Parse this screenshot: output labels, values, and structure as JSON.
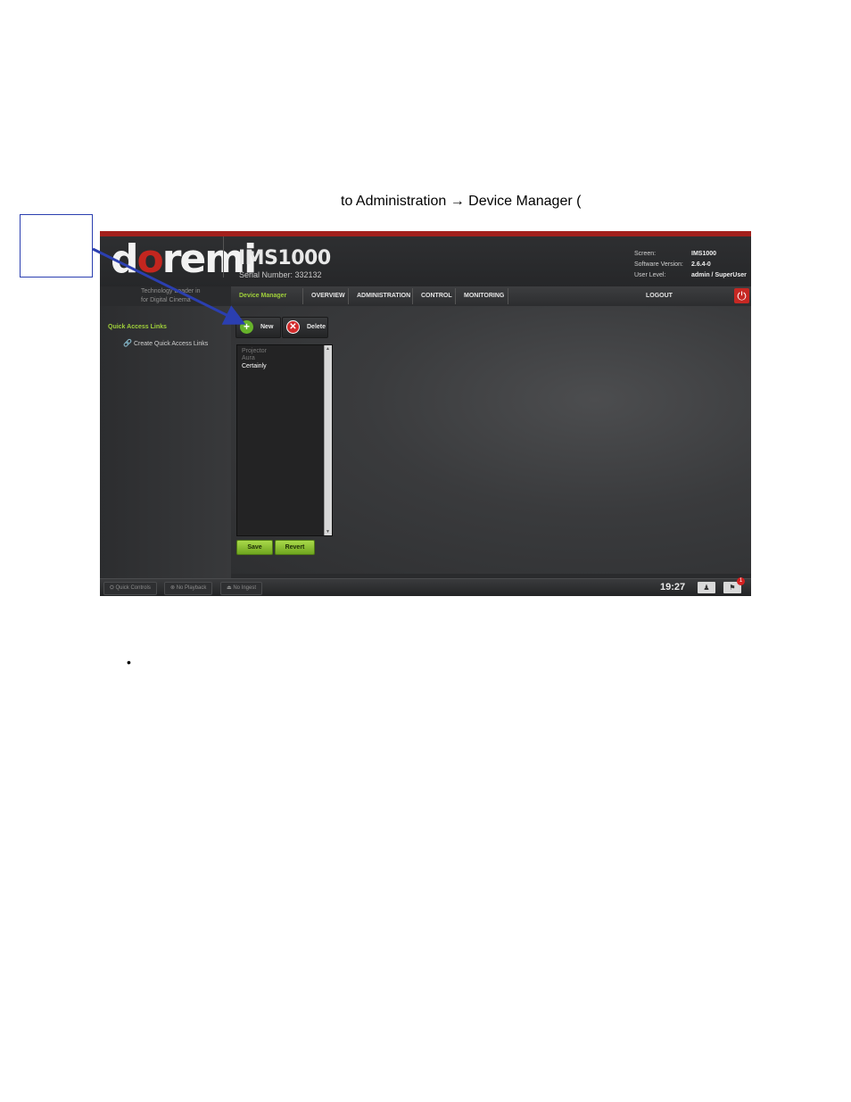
{
  "document": {
    "instruction_text": "to Administration → Device Manager (",
    "bullet": "•"
  },
  "app": {
    "logo": {
      "part1": "d",
      "part2": "o",
      "part3": "remi"
    },
    "tagline_line1": "Technology Leader in",
    "tagline_line2": "for Digital Cinema",
    "product": "IMS1000",
    "serial": "Serial Number: 332132",
    "info": {
      "screen_label": "Screen:",
      "screen_value": "IMS1000",
      "software_label": "Software Version:",
      "software_value": "2.6.4-0",
      "user_label": "User Level:",
      "user_value": "admin / SuperUser"
    }
  },
  "nav": {
    "current": "Device Manager",
    "items": [
      "OVERVIEW",
      "ADMINISTRATION",
      "CONTROL",
      "MONITORING"
    ],
    "logout": "LOGOUT",
    "power_icon": "⏻"
  },
  "sidebar": {
    "title": "Quick Access Links",
    "link": "Create Quick Access Links",
    "link_icon": "🔗"
  },
  "toolbar": {
    "new_label": "New",
    "new_icon": "+",
    "delete_label": "Delete",
    "delete_icon": "✕"
  },
  "device_list": {
    "items": [
      "Projector",
      "Aura",
      "Certainly"
    ]
  },
  "actions": {
    "save": "Save",
    "revert": "Revert"
  },
  "footer": {
    "quick_controls": "Quick Controls",
    "no_playback": "No Playback",
    "no_ingest": "No Ingest",
    "time": "19:27",
    "notifications": "1"
  },
  "colors": {
    "accent_green": "#9fcf3a",
    "brand_red": "#c3261f",
    "annotation_blue": "#2b3fb0"
  }
}
